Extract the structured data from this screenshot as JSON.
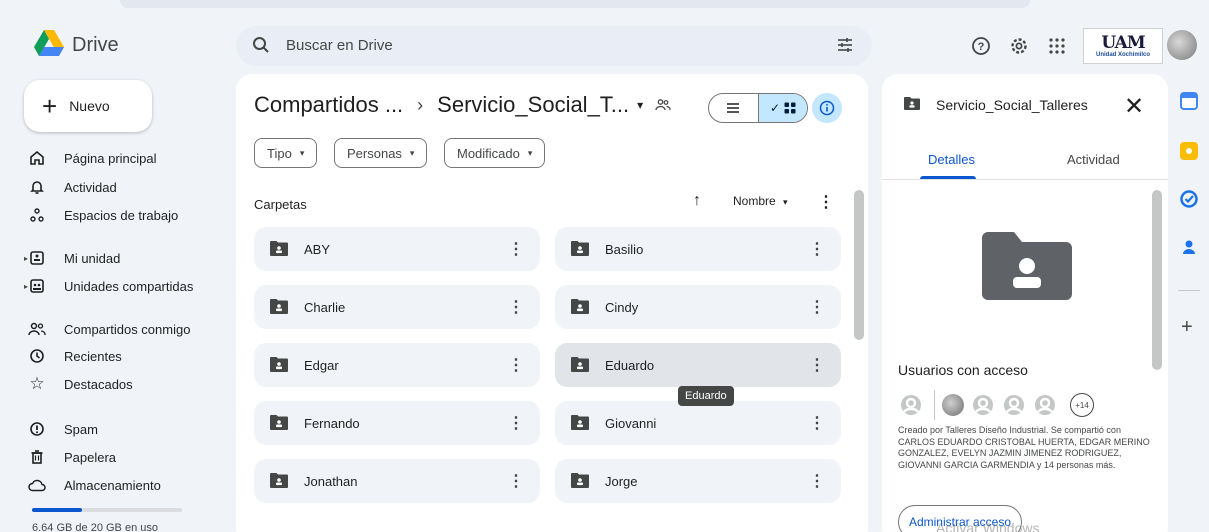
{
  "header": {
    "brand": "Drive",
    "search_placeholder": "Buscar en Drive",
    "org_logo_text": "UAM",
    "org_logo_sub": "Unidad Xochimilco"
  },
  "sidebar": {
    "new_label": "Nuevo",
    "items": [
      {
        "label": "Página principal",
        "icon": "home-icon"
      },
      {
        "label": "Actividad",
        "icon": "bell-icon"
      },
      {
        "label": "Espacios de trabajo",
        "icon": "workspaces-icon"
      },
      {
        "label": "Mi unidad",
        "icon": "my-drive-icon"
      },
      {
        "label": "Unidades compartidas",
        "icon": "shared-drives-icon"
      },
      {
        "label": "Compartidos conmigo",
        "icon": "people-icon"
      },
      {
        "label": "Recientes",
        "icon": "clock-icon"
      },
      {
        "label": "Destacados",
        "icon": "star-icon"
      },
      {
        "label": "Spam",
        "icon": "spam-icon"
      },
      {
        "label": "Papelera",
        "icon": "trash-icon"
      },
      {
        "label": "Almacenamiento",
        "icon": "cloud-icon"
      }
    ],
    "storage_text": "6.64 GB de 20 GB en uso",
    "storage_fraction": 0.33
  },
  "main": {
    "breadcrumb_root": "Compartidos ...",
    "breadcrumb_current": "Servicio_Social_T...",
    "filters": [
      "Tipo",
      "Personas",
      "Modificado"
    ],
    "section_title": "Carpetas",
    "sort_label": "Nombre",
    "folders": [
      {
        "name": "ABY"
      },
      {
        "name": "Basilio"
      },
      {
        "name": "Charlie"
      },
      {
        "name": "Cindy"
      },
      {
        "name": "Edgar"
      },
      {
        "name": "Eduardo"
      },
      {
        "name": "Fernando"
      },
      {
        "name": "Giovanni"
      },
      {
        "name": "Jonathan"
      },
      {
        "name": "Jorge"
      }
    ],
    "tooltip": "Eduardo"
  },
  "details": {
    "title": "Servicio_Social_Talleres",
    "tab_details": "Detalles",
    "tab_activity": "Actividad",
    "access_title": "Usuarios con acceso",
    "more_users": "+14",
    "description": "Creado por Talleres Diseño Industrial. Se compartió con CARLOS EDUARDO CRISTOBAL HUERTA, EDGAR MERINO GONZALEZ, EVELYN JAZMIN JIMENEZ RODRIGUEZ, GIOVANNI GARCIA GARMENDIA y 14 personas más.",
    "manage_button": "Administrar acceso",
    "watermark": "Activar Windows"
  },
  "colors": {
    "accent": "#0b57d0",
    "selected_bg": "#c2e7ff",
    "folder_bg": "#f0f4f9"
  }
}
